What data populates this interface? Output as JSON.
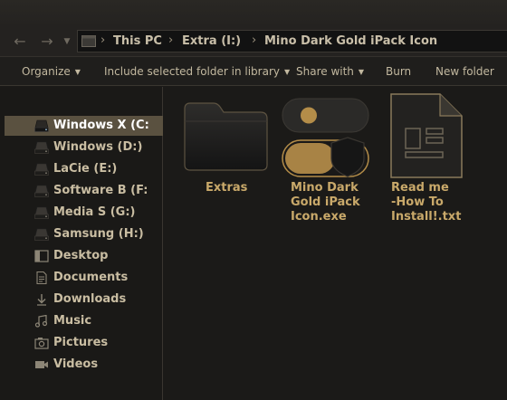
{
  "breadcrumb": [
    "This PC",
    "Extra (I:)",
    "Mino Dark Gold iPack Icon"
  ],
  "toolbar": {
    "organize": "Organize",
    "include": "Include selected folder in library",
    "share": "Share with",
    "burn": "Burn",
    "new_folder": "New folder"
  },
  "sidebar": {
    "items": [
      {
        "label": "Windows X (C:",
        "icon": "drive-icon"
      },
      {
        "label": "Windows (D:)",
        "icon": "drive-icon"
      },
      {
        "label": "LaCie (E:)",
        "icon": "drive-icon"
      },
      {
        "label": "Software B (F:",
        "icon": "drive-icon"
      },
      {
        "label": "Media S (G:)",
        "icon": "drive-icon"
      },
      {
        "label": "Samsung (H:)",
        "icon": "drive-icon"
      },
      {
        "label": "Desktop",
        "icon": "desktop-icon"
      },
      {
        "label": "Documents",
        "icon": "documents-icon"
      },
      {
        "label": "Downloads",
        "icon": "downloads-icon"
      },
      {
        "label": "Music",
        "icon": "music-icon"
      },
      {
        "label": "Pictures",
        "icon": "pictures-icon"
      },
      {
        "label": "Videos",
        "icon": "videos-icon"
      }
    ]
  },
  "files": [
    {
      "lines": [
        "Extras"
      ],
      "icon": "folder-icon"
    },
    {
      "lines": [
        "Mino Dark",
        "Gold iPack",
        "Icon.exe"
      ],
      "icon": "toggle-shield-icon"
    },
    {
      "lines": [
        "Read me",
        "-How To",
        "Install!.txt"
      ],
      "icon": "text-document-icon"
    }
  ],
  "colors": {
    "accent_gold": "#b48d49",
    "selected": "#5a5140",
    "background": "#1b1a18"
  }
}
